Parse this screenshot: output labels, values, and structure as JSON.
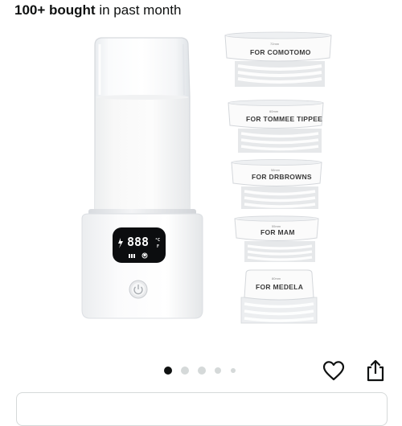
{
  "product": {
    "social_proof": {
      "count_text": "100+ bought",
      "suffix_text": "in past month"
    },
    "warmer": {
      "display_value": "888",
      "display_unit_c": "°C",
      "display_unit_f": "F"
    },
    "adapters": [
      {
        "size": "72mm",
        "label": "FOR COMOTOMO"
      },
      {
        "size": "60mm",
        "label": "FOR TOMMEE TIPPEE"
      },
      {
        "size": "58mm",
        "label": "FOR DRBROWNS"
      },
      {
        "size": "55mm",
        "label": "FOR MAM"
      },
      {
        "size": "80mm",
        "label": "FOR MEDELA"
      }
    ]
  },
  "carousel": {
    "total": 5,
    "active_index": 0
  },
  "actions": {
    "favorite_icon": "heart-outline-icon",
    "share_icon": "share-icon"
  },
  "colors": {
    "active_dot": "#0f1111",
    "inactive_dot": "#d5d9d9",
    "text": "#0f1111"
  }
}
